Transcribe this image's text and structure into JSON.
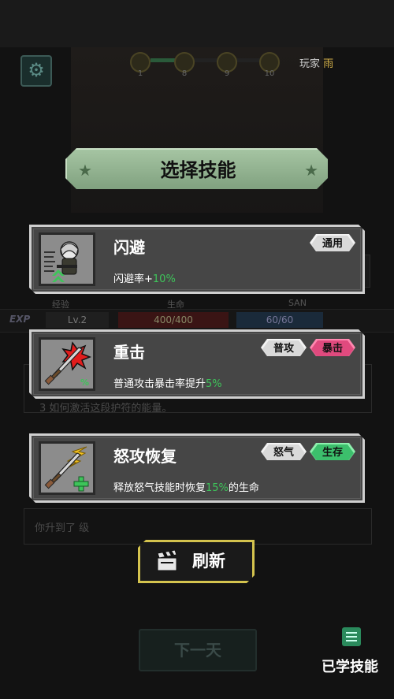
{
  "background": {
    "player_label": "玩家",
    "player_name": "雨",
    "progress_nodes": [
      "1",
      "8",
      "9",
      "10"
    ],
    "progress_fraction": 0.22,
    "stat_headers": [
      "经验",
      "生命",
      "SAN"
    ],
    "exp_label": "EXP",
    "level": "Lv.2",
    "hp": "400/400",
    "san": "60/60",
    "log_line": "3 如何激活这段护符的能量。",
    "log_line2": "你升到了 级",
    "next_day": "下一天"
  },
  "dialog": {
    "title": "选择技能",
    "skills": [
      {
        "name": "闪避",
        "icon": "character-portrait-icon",
        "tags": [
          {
            "label": "通用",
            "style": "grey"
          }
        ],
        "desc_prefix": "闪避率+",
        "desc_value": "10%",
        "desc_suffix": ""
      },
      {
        "name": "重击",
        "icon": "dagger-crit-icon",
        "tags": [
          {
            "label": "普攻",
            "style": "grey"
          },
          {
            "label": "暴击",
            "style": "pink"
          }
        ],
        "desc_prefix": "普通攻击暴击率提升",
        "desc_value": "5%",
        "desc_suffix": ""
      },
      {
        "name": "怒攻恢复",
        "icon": "dagger-heal-icon",
        "tags": [
          {
            "label": "怒气",
            "style": "grey"
          },
          {
            "label": "生存",
            "style": "green"
          }
        ],
        "desc_prefix": "释放怒气技能时恢复",
        "desc_value": "15%",
        "desc_suffix": "的生命"
      }
    ],
    "refresh_label": "刷新",
    "icon_badge_percent": "%"
  },
  "learned_skills_label": "已学技能",
  "colors": {
    "highlight_value": "#3ec45a",
    "tag_pink": "#e04a7e",
    "tag_green": "#3cbf6c",
    "refresh_border": "#d4c34e",
    "title_banner": "#8fb08c"
  }
}
